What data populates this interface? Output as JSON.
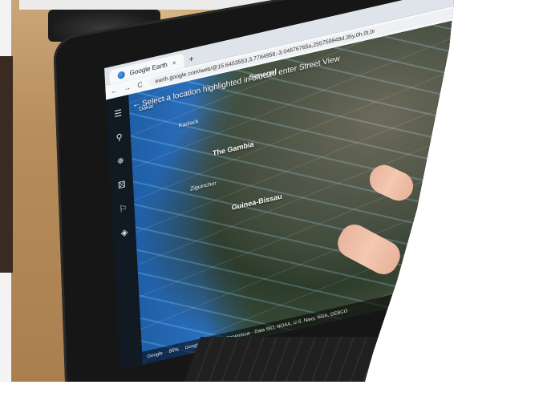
{
  "browser": {
    "tab_title": "Google Earth",
    "tab_close": "×",
    "new_tab": "+",
    "url": "earth.google.com/web/@15.6453553,3.7784958,-3.04676765a,255759949d,35y,0h,0t,0r",
    "nav": {
      "back": "←",
      "forward": "→",
      "reload": "C"
    }
  },
  "earth": {
    "hint": "Select a location highlighted in blue to enter Street View",
    "back": "←",
    "places": [
      {
        "label": "Dakar"
      },
      {
        "label": "Senegal"
      },
      {
        "label": "Kaolack"
      },
      {
        "label": "The Gambia"
      },
      {
        "label": "Ziguinchor"
      },
      {
        "label": "Guinea-Bissau"
      }
    ],
    "sidebar_icons": [
      "menu-icon",
      "search-icon",
      "voyager-icon",
      "dice-icon",
      "projects-icon",
      "layers-icon"
    ],
    "bottom_bar": {
      "brand": "Google",
      "zoom": "85%",
      "attribution": "Google · Landsat / Copernicus · Data SIO, NOAA, U.S. Navy, NGA, GEBCO"
    },
    "controls": [
      "◍",
      "◉",
      "◎",
      "●",
      "◆"
    ]
  }
}
